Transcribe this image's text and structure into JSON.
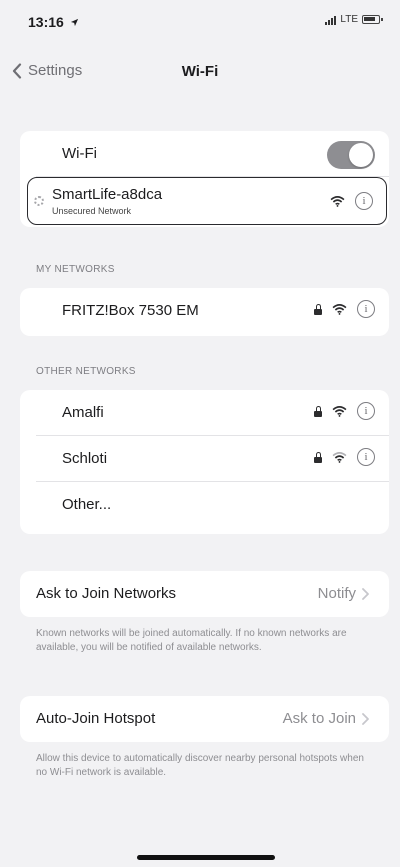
{
  "status_bar": {
    "time": "13:16",
    "network": "LTE"
  },
  "nav": {
    "back_label": "Settings",
    "title": "Wi-Fi"
  },
  "wifi": {
    "toggle_label": "Wi-Fi",
    "toggle_on": true,
    "connecting_network": {
      "name": "SmartLife-a8dca",
      "subtitle": "Unsecured Network"
    }
  },
  "my_networks": {
    "header": "MY NETWORKS",
    "items": [
      {
        "name": "FRITZ!Box 7530 EM",
        "secured": true
      }
    ]
  },
  "other_networks": {
    "header": "OTHER NETWORKS",
    "items": [
      {
        "name": "Amalfi",
        "secured": true
      },
      {
        "name": "Schloti",
        "secured": true
      }
    ],
    "other_label": "Other..."
  },
  "ask_to_join": {
    "label": "Ask to Join Networks",
    "value": "Notify",
    "footer": "Known networks will be joined automatically. If no known networks are available, you will be notified of available networks."
  },
  "auto_join_hotspot": {
    "label": "Auto-Join Hotspot",
    "value": "Ask to Join",
    "footer": "Allow this device to automatically discover nearby personal hotspots when no Wi-Fi network is available."
  },
  "icons": {
    "info": "info-circle-icon",
    "wifi": "wifi-signal-icon",
    "lock": "lock-icon",
    "back": "chevron-left-icon",
    "disclosure": "chevron-right-icon"
  },
  "colors": {
    "toggle_on": "#8e8e92",
    "background": "#f2f2f4",
    "secondary_text": "#8e8e92"
  }
}
